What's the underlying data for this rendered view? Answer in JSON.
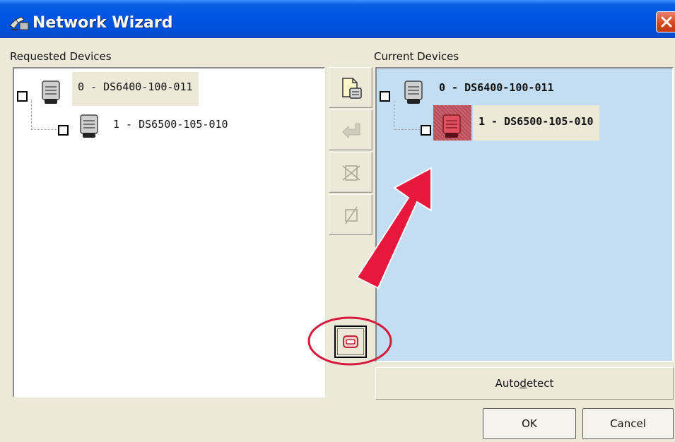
{
  "window": {
    "title": "Network Wizard",
    "icon": "network-wizard-icon",
    "close_icon": "close-icon"
  },
  "requested": {
    "label": "Requested Devices",
    "devices": [
      {
        "label": "0 - DS6400-100-011"
      },
      {
        "label": "1 - DS6500-105-010"
      }
    ]
  },
  "current": {
    "label": "Current Devices",
    "devices": [
      {
        "label": "0 - DS6400-100-011"
      },
      {
        "label": "1 - DS6500-105-010"
      }
    ]
  },
  "toolbar": {
    "buttons": [
      "add-device-icon",
      "move-back-icon",
      "delete-device-icon",
      "clear-icon",
      "scan-device-icon"
    ]
  },
  "buttons": {
    "autodetect": "Autodetect",
    "autodetect_mnemonic_index": 4,
    "ok": "OK",
    "cancel": "Cancel"
  },
  "colors": {
    "titlebar": "#0054e3",
    "current_panel_bg": "#c3def3",
    "annotation_red": "#e8173c",
    "device_highlight": "#d9263a"
  }
}
